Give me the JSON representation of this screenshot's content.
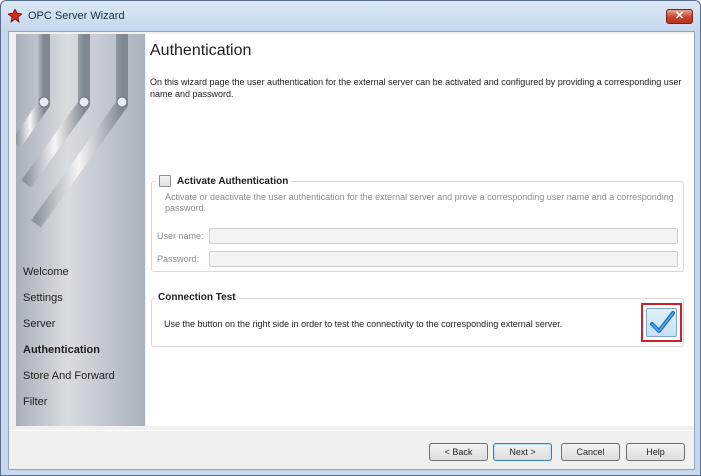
{
  "window": {
    "title": "OPC Server Wizard",
    "close_label": "✕"
  },
  "sidebar": {
    "items": [
      {
        "label": "Welcome",
        "active": false
      },
      {
        "label": "Settings",
        "active": false
      },
      {
        "label": "Server",
        "active": false
      },
      {
        "label": "Authentication",
        "active": true
      },
      {
        "label": "Store And Forward",
        "active": false
      },
      {
        "label": "Filter",
        "active": false
      }
    ]
  },
  "page": {
    "title": "Authentication",
    "description": "On this wizard page the user authentication for the external server can be activated and configured by providing a corresponding user name and password."
  },
  "authentication": {
    "checkbox_label": "Activate Authentication",
    "checked": false,
    "hint": "Activate or deactivate the user authentication for the external server and prove a corresponding user name and a corresponding password.",
    "username_label": "User name:",
    "username_value": "",
    "password_label": "Password:",
    "password_value": ""
  },
  "connection_test": {
    "legend": "Connection Test",
    "text": "Use the button on the right side in order to test the connectivity to the corresponding external server.",
    "icon": "checkmark-icon"
  },
  "buttons": {
    "back": "< Back",
    "next": "Next >",
    "cancel": "Cancel",
    "help": "Help"
  },
  "colors": {
    "highlight_border": "#c8232c",
    "checkmark": "#1f6fb8"
  }
}
